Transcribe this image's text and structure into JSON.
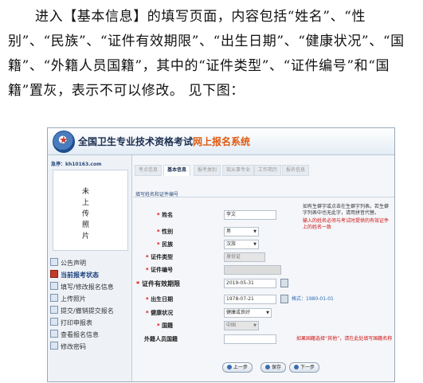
{
  "paragraph": {
    "text": "进入【基本信息】的填写页面，内容包括“姓名”、“性别”、“民族”、“证件有效期限”、“出生日期”、“健康状况”、“国籍”、“外籍人员国籍”，其中的“证件类型”、“证件编号”和“国籍”置灰，表示不可以修改。 见下图："
  },
  "screenshot": {
    "banner": {
      "title_main": "全国卫生专业技术资格考试",
      "title_highlight": "网上报名系统"
    },
    "sidebar": {
      "user_id": "急停：kh10163.com",
      "photo_text": "未上传照片",
      "menu": [
        {
          "label": "公告声明",
          "active": false
        },
        {
          "label": "当前报考状态",
          "active": true
        },
        {
          "label": "填写/修改报名信息",
          "active": false
        },
        {
          "label": "上传照片",
          "active": false
        },
        {
          "label": "提交/撤销提交报名",
          "active": false
        },
        {
          "label": "打印申报表",
          "active": false
        },
        {
          "label": "查看报名信息",
          "active": false
        },
        {
          "label": "修改密码",
          "active": false
        }
      ]
    },
    "tabs": [
      "考点信息",
      "基本信息",
      "报考类别",
      "现从事专业",
      "工作简历",
      "报名信息"
    ],
    "active_tab": "基本信息",
    "section_title": "填写姓名和证件编号",
    "fields": {
      "name": {
        "label": "姓名",
        "value": "李文"
      },
      "gender": {
        "label": "性别",
        "value": "男"
      },
      "ethnicity": {
        "label": "民族",
        "value": "汉族"
      },
      "id_type": {
        "label": "证件类型",
        "value": "身份证"
      },
      "id_number": {
        "label": "证件编号",
        "value": ""
      },
      "id_validity": {
        "label": "证件有效期限",
        "value": "2019-05-31"
      },
      "birth_date": {
        "label": "出生日期",
        "value": "1978-07-21"
      },
      "health": {
        "label": "健康状况",
        "value": "健康或良好"
      },
      "nationality": {
        "label": "国籍",
        "value": "中国"
      },
      "foreign_nationality": {
        "label": "外籍人员国籍",
        "value": ""
      }
    },
    "notes": {
      "name_hint": "如有生僻字或点击在生僻字列表。若生僻字列表中也无此字，请用拼音代替。",
      "name_link": "生僻字列表",
      "name_warning": "输入的姓名必须与考试时提供的有效证件上的姓名一致",
      "birth_format": "格式：1980-01-01",
      "foreign_note": "如果国籍选择“其他”，请在此处填写国籍名称"
    },
    "buttons": {
      "prev": "上一步",
      "save": "保存",
      "next": "下一步"
    },
    "colors": {
      "accent_red": "#d01010",
      "highlight_orange": "#e05a10",
      "link_blue": "#2b6bb8"
    }
  }
}
